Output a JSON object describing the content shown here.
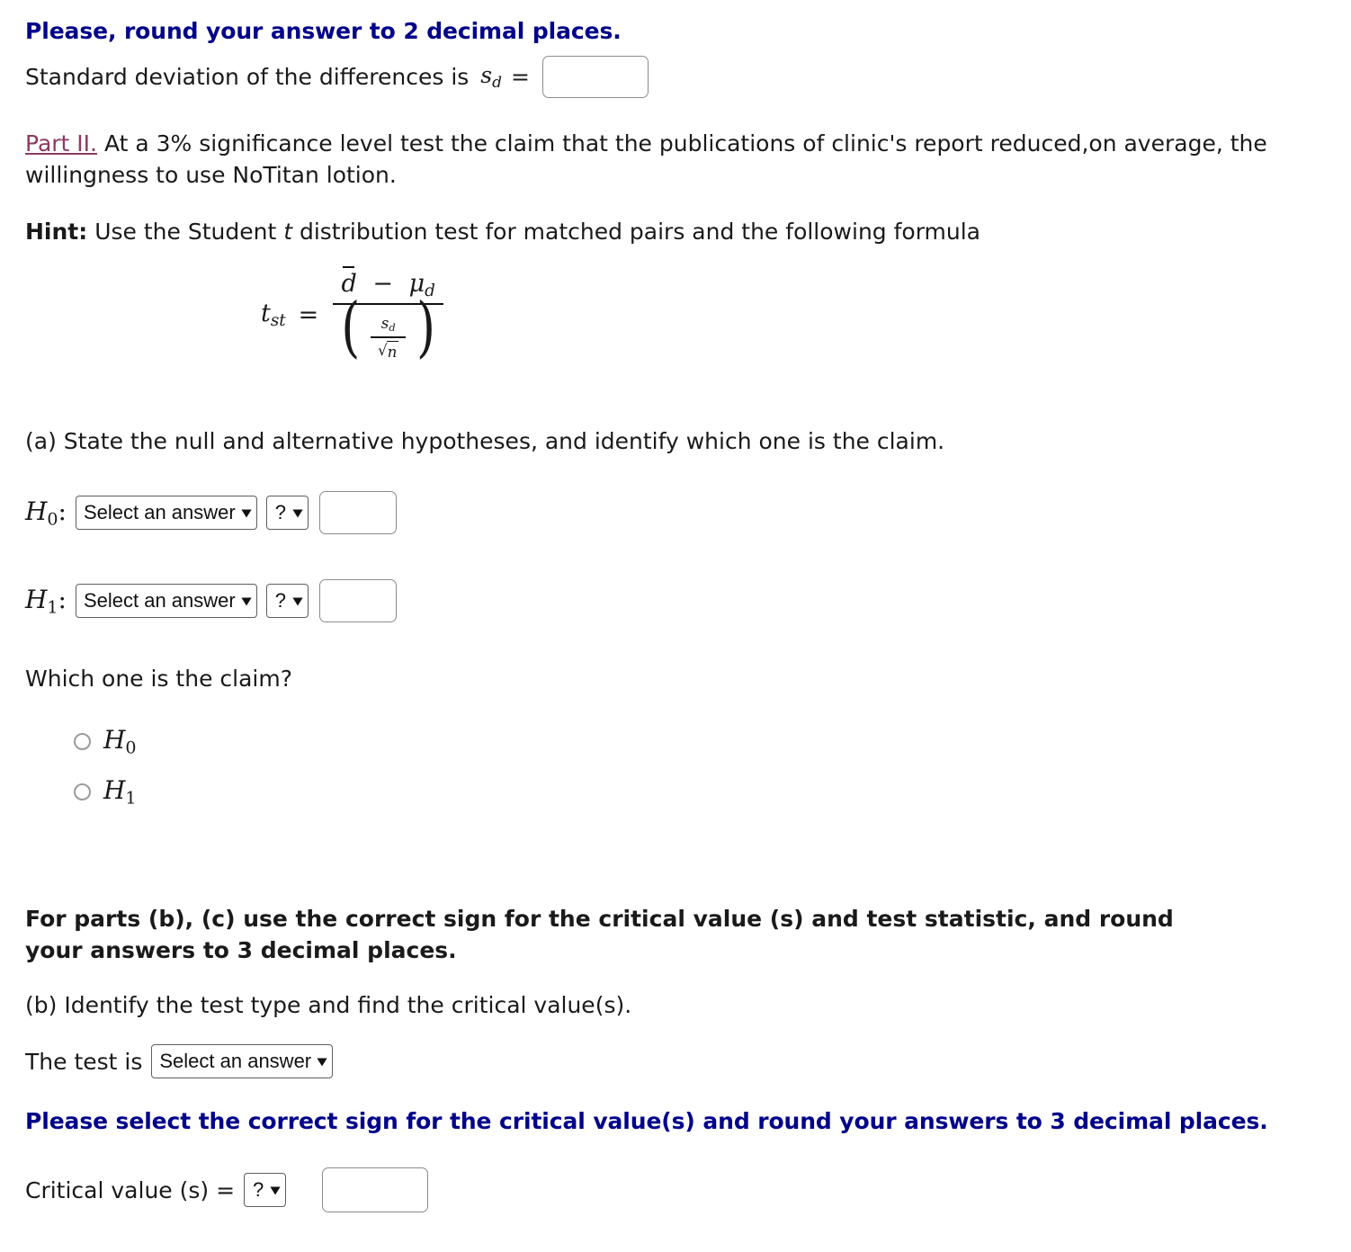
{
  "rounding_note_top": "Please, round your answer to 2 decimal places.",
  "sd_line": {
    "label": "Standard deviation of the differences is",
    "symbol": "s",
    "symbol_sub": "d",
    "equals": "=",
    "input_value": "",
    "input_placeholder": ""
  },
  "part_two": {
    "link_label": "Part II.",
    "text": "At a 3% significance level test the claim that the publications of clinic's report reduced,on average, the willingness to use NoTitan lotion."
  },
  "hint": {
    "label": "Hint:",
    "text_before": "Use the Student",
    "italic_symbol": "t",
    "text_after": "distribution test for matched pairs and the following formula"
  },
  "formula": {
    "lhs": "t",
    "lhs_sub": "st",
    "equals": "=",
    "numerator_mean": "d",
    "numerator_minus": "−",
    "numerator_mu": "μ",
    "numerator_mu_sub": "d",
    "denominator_s": "s",
    "denominator_s_sub": "d",
    "denominator_radic": "√",
    "denominator_n": "n",
    "paren_open": "(",
    "paren_close": ")"
  },
  "part_a": {
    "prompt": "(a) State the null and alternative hypotheses, and identify which one is the claim.",
    "h0": {
      "label": "H",
      "label_sub": "0",
      "colon": ":",
      "select_answer_value": "Select an answer",
      "sign_select_value": "?",
      "input_value": ""
    },
    "h1": {
      "label": "H",
      "label_sub": "1",
      "colon": ":",
      "select_answer_value": "Select an answer",
      "sign_select_value": "?",
      "input_value": ""
    },
    "claim_question": "Which one is the claim?",
    "claim_options": [
      {
        "label": "H",
        "sub": "0",
        "selected": false
      },
      {
        "label": "H",
        "sub": "1",
        "selected": false
      }
    ]
  },
  "parts_bc_note": "For parts (b), (c) use the correct sign for the critical value (s) and test statistic, and round your answers to 3 decimal places.",
  "part_b": {
    "prompt": "(b) Identify the test type and find the critical value(s).",
    "test_is_label": "The test is",
    "test_select_value": "Select an answer",
    "sign_note": "Please select the correct sign for the critical value(s) and round your answers to 3 decimal places.",
    "critical_value_label": "Critical value (s) =",
    "critical_sign_value": "?",
    "critical_input_value": ""
  },
  "icons": {
    "chevron_down": "⌄",
    "chevron_glyph": "▾"
  },
  "colors": {
    "heading_blue": "#00008b",
    "link_maroon": "#8b3a62",
    "body_text": "#1a1a1a",
    "input_border": "#8c8c8c",
    "select_border": "#5e5e5e"
  }
}
